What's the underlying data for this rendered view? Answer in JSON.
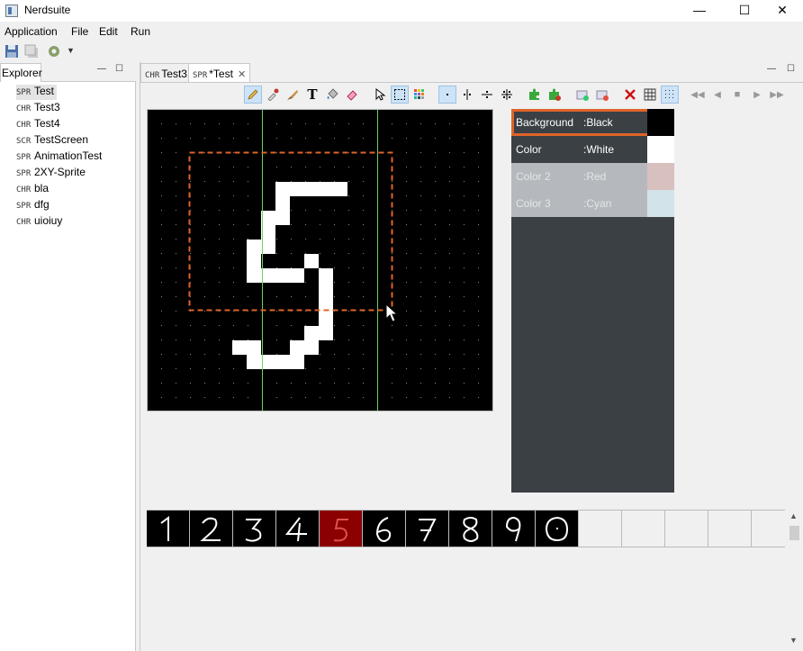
{
  "window": {
    "title": "Nerdsuite",
    "minimize": "—",
    "maximize": "☐",
    "close": "✕"
  },
  "menu": [
    "Application",
    "File",
    "Edit",
    "Run"
  ],
  "explorer": {
    "tab_label": "Explorer",
    "items": [
      {
        "kind": "SPR",
        "name": "Test",
        "selected": true
      },
      {
        "kind": "CHR",
        "name": "Test3"
      },
      {
        "kind": "CHR",
        "name": "Test4"
      },
      {
        "kind": "SCR",
        "name": "TestScreen"
      },
      {
        "kind": "SPR",
        "name": "AnimationTest"
      },
      {
        "kind": "SPR",
        "name": "2XY-Sprite"
      },
      {
        "kind": "CHR",
        "name": "bla"
      },
      {
        "kind": "SPR",
        "name": "dfg"
      },
      {
        "kind": "CHR",
        "name": "uioiuy"
      }
    ]
  },
  "editor_tabs": [
    {
      "kind": "CHR",
      "name": "Test3",
      "active": false
    },
    {
      "kind": "SPR",
      "name": "*Test",
      "active": true,
      "close": "✕"
    }
  ],
  "palette": {
    "rows": [
      {
        "name": "Background",
        "value": ":Black",
        "color": "#000000",
        "selected": true,
        "enabled": true
      },
      {
        "name": "Color",
        "value": ":White",
        "color": "#ffffff",
        "enabled": true
      },
      {
        "name": "Color 2",
        "value": ":Red",
        "color": "#d8c0bf",
        "enabled": false
      },
      {
        "name": "Color 3",
        "value": ":Cyan",
        "color": "#d3e3ea",
        "enabled": false
      }
    ]
  },
  "colors": {
    "accent": "#e0642a",
    "panel": "#3b4045",
    "selected_cell": "#8b0000",
    "grid_line": "#6fcf6f"
  },
  "strip": {
    "selected_index": 4,
    "cells": [
      "1",
      "2",
      "3",
      "4",
      "5",
      "6",
      "7",
      "8",
      "9",
      "0",
      "",
      "",
      "",
      "",
      ""
    ]
  }
}
